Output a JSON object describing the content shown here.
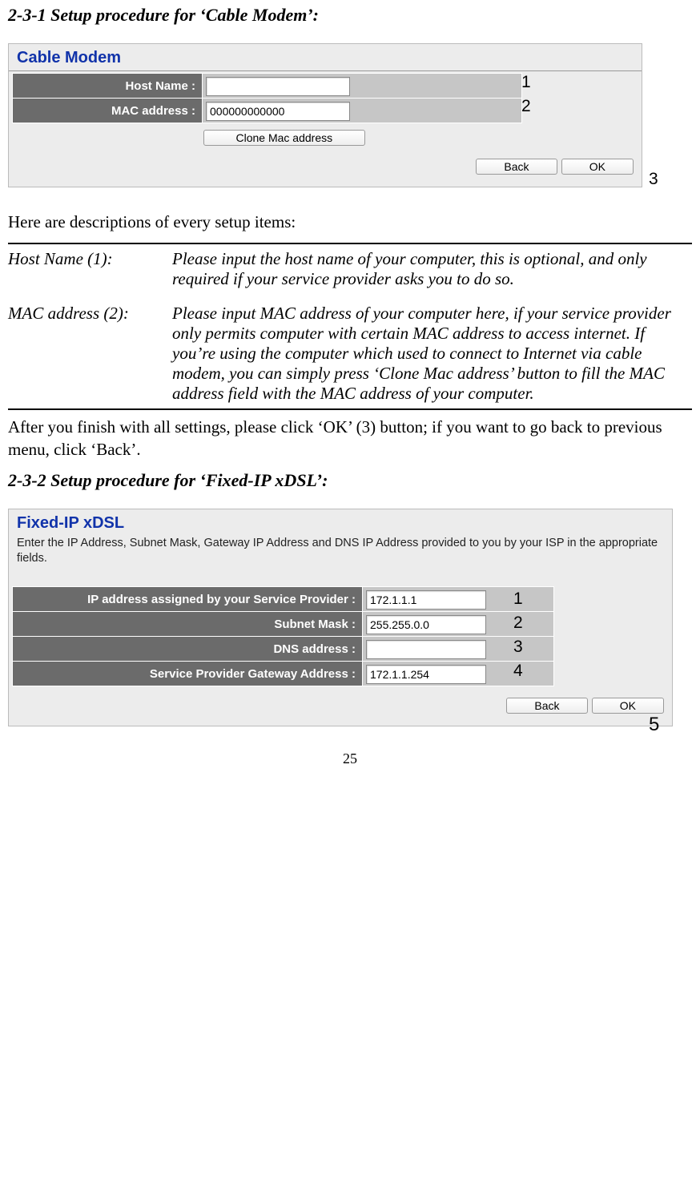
{
  "section1_heading": "2-3-1 Setup procedure for ‘Cable Modem’:",
  "panel1": {
    "title": "Cable Modem",
    "host_label": "Host Name :",
    "host_value": "",
    "mac_label": "MAC address :",
    "mac_value": "000000000000",
    "clone_btn": "Clone Mac address",
    "back_btn": "Back",
    "ok_btn": "OK",
    "annot1": "1",
    "annot2": "2",
    "annot3": "3"
  },
  "intro_text": "Here are descriptions of every setup items:",
  "desc1_term": "Host Name (1):",
  "desc1_def": "Please input the host name of your computer, this is optional, and only required if your service provider asks you to do so.",
  "desc2_term": "MAC address (2):",
  "desc2_def": "Please input MAC address of your computer here, if your service provider only permits computer with certain MAC address to access internet. If you’re using the computer which used to connect to Internet via cable modem, you can simply press ‘Clone Mac address’ button to fill the MAC address field with the MAC address of your computer.",
  "after_text": "After you finish with all settings, please click ‘OK’ (3) button; if you want to go back to previous menu, click ‘Back’.",
  "section2_heading": "2-3-2 Setup procedure for ‘Fixed-IP xDSL’:",
  "panel2": {
    "title": "Fixed-IP xDSL",
    "subtitle": "Enter the IP Address, Subnet Mask, Gateway IP Address and DNS IP Address provided to you by your ISP in the appropriate fields.",
    "ip_label": "IP address assigned by your Service Provider :",
    "ip_value": "172.1.1.1",
    "mask_label": "Subnet Mask :",
    "mask_value": "255.255.0.0",
    "dns_label": "DNS address :",
    "dns_value": "",
    "gw_label": "Service Provider Gateway Address :",
    "gw_value": "172.1.1.254",
    "back_btn": "Back",
    "ok_btn": "OK",
    "a1": "1",
    "a2": "2",
    "a3": "3",
    "a4": "4",
    "a5": "5"
  },
  "page_number": "25"
}
